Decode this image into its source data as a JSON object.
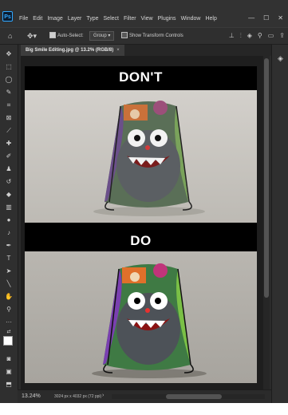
{
  "app": {
    "logo": "Ps",
    "menu": [
      "File",
      "Edit",
      "Image",
      "Layer",
      "Type",
      "Select",
      "Filter",
      "View",
      "Plugins",
      "Window",
      "Help"
    ],
    "window_controls": {
      "minimize": "—",
      "maximize": "☐",
      "close": "✕"
    }
  },
  "options_bar": {
    "auto_select_label": "Auto-Select:",
    "auto_select_checked": true,
    "auto_select_value": "Group",
    "transform_controls_label": "Show Transform Controls",
    "transform_controls_checked": false,
    "right_icons": [
      "align-icon",
      "distribute-icon",
      "3d-mode-icon",
      "search-icon",
      "workspace-icon",
      "share-icon"
    ]
  },
  "document_tab": {
    "title": "Big Smile Editing.jpg @ 13.2% (RGB/8)",
    "close": "×"
  },
  "canvas": {
    "top_heading": "DON'T",
    "bottom_heading": "DO",
    "colors": {
      "background": "#000000",
      "heading": "#ffffff",
      "backdrop": "#cbc8c3"
    }
  },
  "status_bar": {
    "zoom": "13.24%",
    "dimensions": "3024 px x 4032 px (72 ppi)",
    "arrow": "›"
  },
  "tools": [
    "move-icon",
    "marquee-icon",
    "lasso-icon",
    "quick-select-icon",
    "crop-icon",
    "frame-icon",
    "eyedropper-icon",
    "healing-brush-icon",
    "brush-icon",
    "clone-stamp-icon",
    "history-brush-icon",
    "eraser-icon",
    "gradient-icon",
    "blur-icon",
    "dodge-icon",
    "pen-icon",
    "type-icon",
    "path-select-icon",
    "rectangle-icon",
    "hand-icon",
    "zoom-icon",
    "more-tools-icon",
    "color-swatch-icon",
    "quick-mask-icon",
    "screen-mode-icon"
  ]
}
